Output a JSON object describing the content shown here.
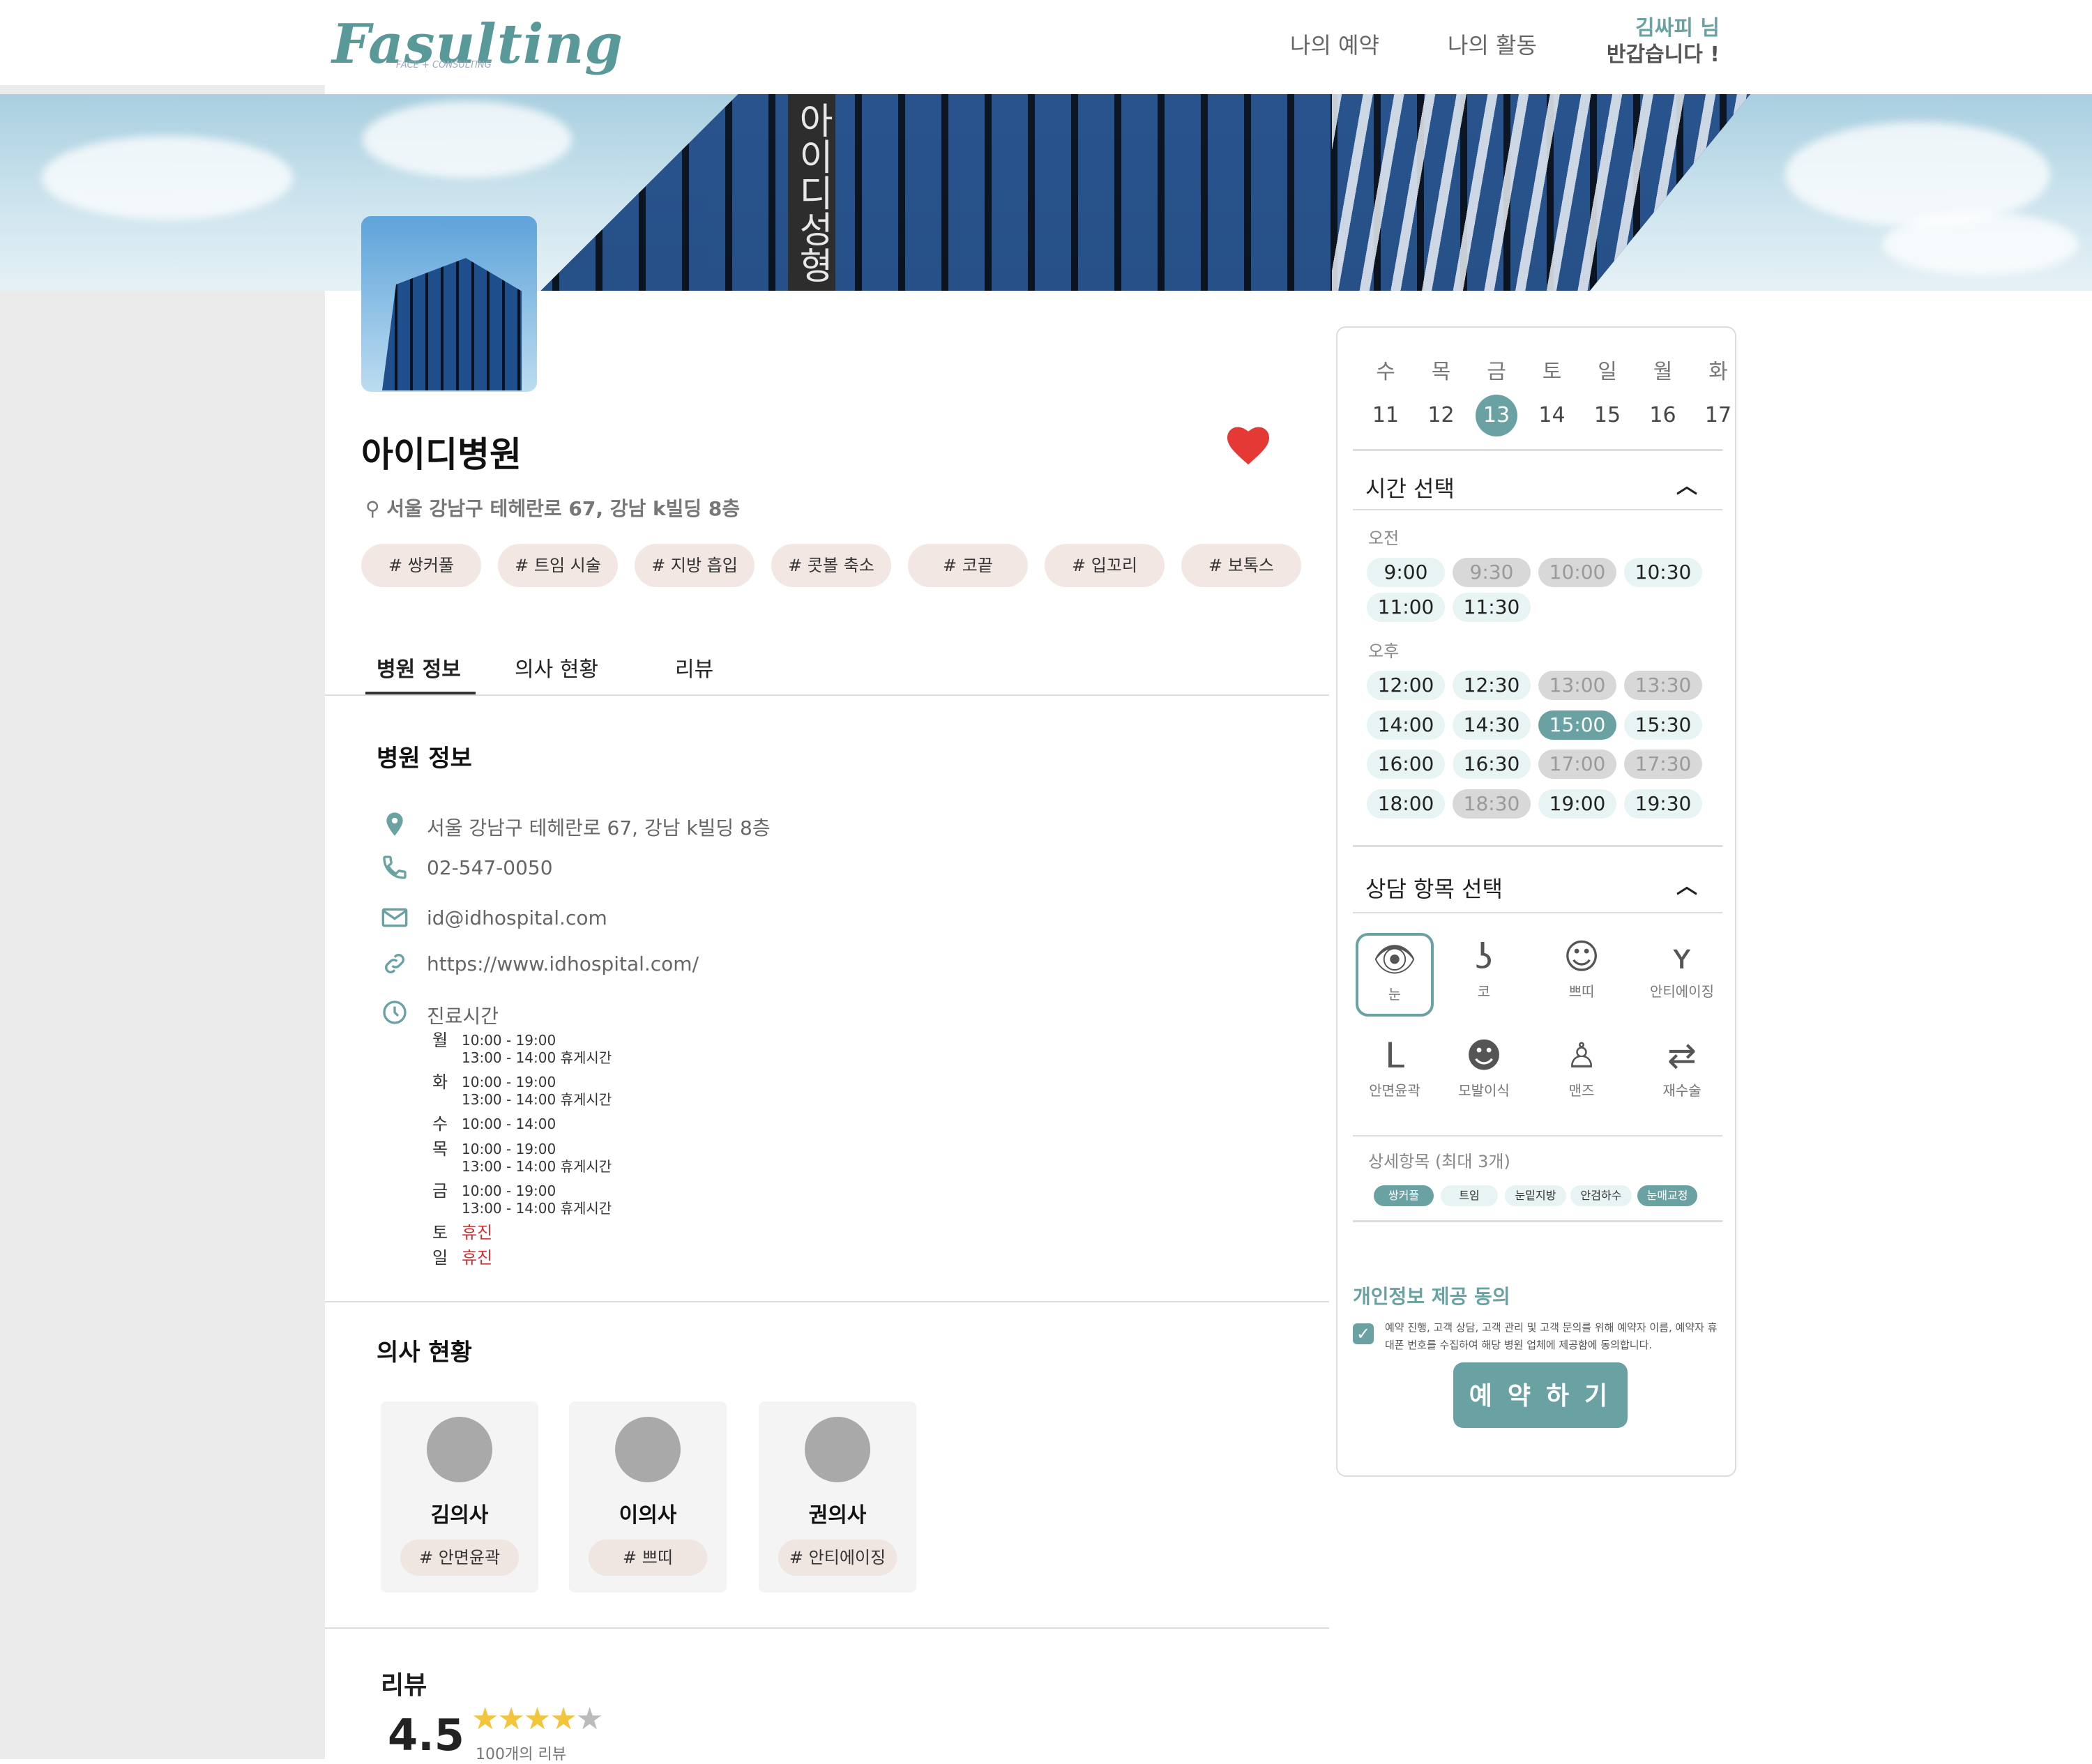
{
  "header": {
    "logo": "Fasulting",
    "logo_sub": "FACE + CONSULTING",
    "nav": [
      "나의 예약",
      "나의 활동"
    ],
    "greeting_name": "김싸피 님",
    "greeting_text": "반갑습니다 !"
  },
  "banner": {
    "sign_text": "아이디성형"
  },
  "hospital": {
    "name": "아이디병원",
    "address": "서울 강남구 테헤란로 67, 강남 k빌딩 8층",
    "tags": [
      "# 쌍커풀",
      "# 트임 시술",
      "# 지방 흡입",
      "# 콧볼 축소",
      "# 코끝",
      "# 입꼬리",
      "# 보톡스"
    ]
  },
  "tabs": [
    "병원 정보",
    "의사 현황",
    "리뷰"
  ],
  "info": {
    "title": "병원 정보",
    "address": "서울 강남구 테헤란로 67, 강남 k빌딩 8층",
    "phone": "02-547-0050",
    "email": "id@idhospital.com",
    "url": "https://www.idhospital.com/",
    "hours_label": "진료시간",
    "hours": [
      {
        "day": "월",
        "l1": "10:00 - 19:00",
        "l2": "13:00 - 14:00 휴게시간"
      },
      {
        "day": "화",
        "l1": "10:00 - 19:00",
        "l2": "13:00 - 14:00 휴게시간"
      },
      {
        "day": "수",
        "l1": "10:00 - 14:00",
        "l2": ""
      },
      {
        "day": "목",
        "l1": "10:00 - 19:00",
        "l2": "13:00 - 14:00 휴게시간"
      },
      {
        "day": "금",
        "l1": "10:00 - 19:00",
        "l2": "13:00 - 14:00 휴게시간"
      },
      {
        "day": "토",
        "l1": "휴진",
        "l2": ""
      },
      {
        "day": "일",
        "l1": "휴진",
        "l2": ""
      }
    ]
  },
  "doctors": {
    "title": "의사 현황",
    "list": [
      {
        "name": "김의사",
        "tag": "# 안면윤곽"
      },
      {
        "name": "이의사",
        "tag": "# 쁘띠"
      },
      {
        "name": "권의사",
        "tag": "# 안티에이징"
      }
    ]
  },
  "review": {
    "title": "리뷰",
    "score": "4.5",
    "rating": 4.5,
    "count": "100개의 리뷰"
  },
  "booking": {
    "days": [
      {
        "name": "수",
        "num": "11"
      },
      {
        "name": "목",
        "num": "12"
      },
      {
        "name": "금",
        "num": "13"
      },
      {
        "name": "토",
        "num": "14"
      },
      {
        "name": "일",
        "num": "15"
      },
      {
        "name": "월",
        "num": "16"
      },
      {
        "name": "화",
        "num": "17"
      }
    ],
    "selected_day": "13",
    "time_title": "시간 선택",
    "am_label": "오전",
    "pm_label": "오후",
    "am_slots": [
      {
        "t": "9:00",
        "s": "open"
      },
      {
        "t": "9:30",
        "s": "disabled"
      },
      {
        "t": "10:00",
        "s": "disabled"
      },
      {
        "t": "10:30",
        "s": "open"
      },
      {
        "t": "11:00",
        "s": "open"
      },
      {
        "t": "11:30",
        "s": "open"
      }
    ],
    "pm_slots": [
      {
        "t": "12:00",
        "s": "open"
      },
      {
        "t": "12:30",
        "s": "open"
      },
      {
        "t": "13:00",
        "s": "disabled"
      },
      {
        "t": "13:30",
        "s": "disabled"
      },
      {
        "t": "14:00",
        "s": "open"
      },
      {
        "t": "14:30",
        "s": "open"
      },
      {
        "t": "15:00",
        "s": "selected"
      },
      {
        "t": "15:30",
        "s": "open"
      },
      {
        "t": "16:00",
        "s": "open"
      },
      {
        "t": "16:30",
        "s": "open"
      },
      {
        "t": "17:00",
        "s": "disabled"
      },
      {
        "t": "17:30",
        "s": "disabled"
      },
      {
        "t": "18:00",
        "s": "open"
      },
      {
        "t": "18:30",
        "s": "disabled"
      },
      {
        "t": "19:00",
        "s": "open"
      },
      {
        "t": "19:30",
        "s": "open"
      }
    ],
    "consult_title": "상담 항목 선택",
    "categories": [
      {
        "label": "눈",
        "icon": "eye-icon",
        "selected": true
      },
      {
        "label": "코",
        "icon": "nose-icon",
        "selected": false
      },
      {
        "label": "쁘띠",
        "icon": "face-injection-icon",
        "selected": false
      },
      {
        "label": "안티에이징",
        "icon": "face-lift-icon",
        "selected": false
      },
      {
        "label": "안면윤곽",
        "icon": "jawline-icon",
        "selected": false
      },
      {
        "label": "모발이식",
        "icon": "hair-icon",
        "selected": false
      },
      {
        "label": "맨즈",
        "icon": "man-icon",
        "selected": false
      },
      {
        "label": "재수술",
        "icon": "repeat-icon",
        "selected": false
      }
    ],
    "detail_label": "상세항목 (최대 3개)",
    "details": [
      {
        "label": "쌍커풀",
        "selected": true
      },
      {
        "label": "트임",
        "selected": false
      },
      {
        "label": "눈밑지방",
        "selected": false
      },
      {
        "label": "안검하수",
        "selected": false
      },
      {
        "label": "눈매교정",
        "selected": true
      }
    ],
    "consent_title": "개인정보 제공 동의",
    "consent_text": "예약 진행, 고객 상담, 고객 관리 및 고객 문의를 위해 예약자 이름, 예약자 휴대폰 번호를 수집하여 해당 병원 업체에 제공함에 동의합니다.",
    "book_label": "예 약 하 기"
  },
  "colors": {
    "accent": "#6aa2a4",
    "tag_bg": "#f2e7e3",
    "heart": "#e53935",
    "closed": "#d23030"
  }
}
